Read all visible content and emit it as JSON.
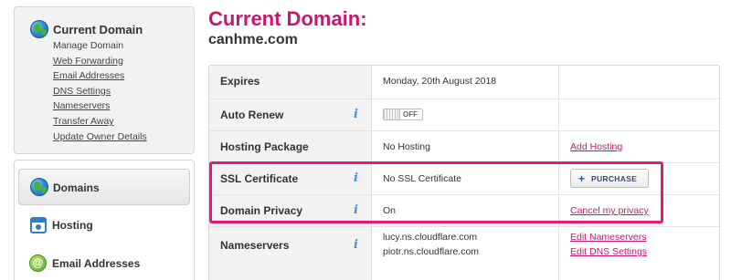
{
  "domain_context": {
    "title": "Current Domain",
    "links": [
      {
        "label": "Manage Domain",
        "underlined": false
      },
      {
        "label": "Web Forwarding",
        "underlined": true
      },
      {
        "label": "Email Addresses",
        "underlined": true
      },
      {
        "label": "DNS Settings",
        "underlined": true
      },
      {
        "label": "Nameservers",
        "underlined": true
      },
      {
        "label": "Transfer Away",
        "underlined": true
      },
      {
        "label": "Update Owner Details",
        "underlined": true
      }
    ]
  },
  "products_nav": {
    "items": [
      {
        "label": "Domains",
        "icon": "globe-icon",
        "active": true
      },
      {
        "label": "Hosting",
        "icon": "hosting-icon",
        "active": false
      },
      {
        "label": "Email Addresses",
        "icon": "email-icon",
        "active": false
      }
    ]
  },
  "main": {
    "heading": "Current Domain:",
    "domain_name": "canhme.com"
  },
  "details": {
    "expires": {
      "label": "Expires",
      "value": "Monday, 20th August 2018"
    },
    "auto_renew": {
      "label": "Auto Renew",
      "toggle_state": "OFF"
    },
    "hosting_package": {
      "label": "Hosting Package",
      "value": "No Hosting",
      "action": "Add Hosting"
    },
    "ssl_certificate": {
      "label": "SSL Certificate",
      "value": "No SSL Certificate",
      "action": "PURCHASE"
    },
    "domain_privacy": {
      "label": "Domain Privacy",
      "value": "On",
      "action": "Cancel my privacy"
    },
    "nameservers": {
      "label": "Nameservers",
      "values": [
        "lucy.ns.cloudflare.com",
        "piotr.ns.cloudflare.com"
      ],
      "actions": [
        "Edit Nameservers",
        "Edit DNS Settings"
      ]
    }
  },
  "info_icon_glyph": "i",
  "colors": {
    "accent": "#c8186e",
    "highlight": "#e21c73",
    "info": "#4a90d9"
  }
}
